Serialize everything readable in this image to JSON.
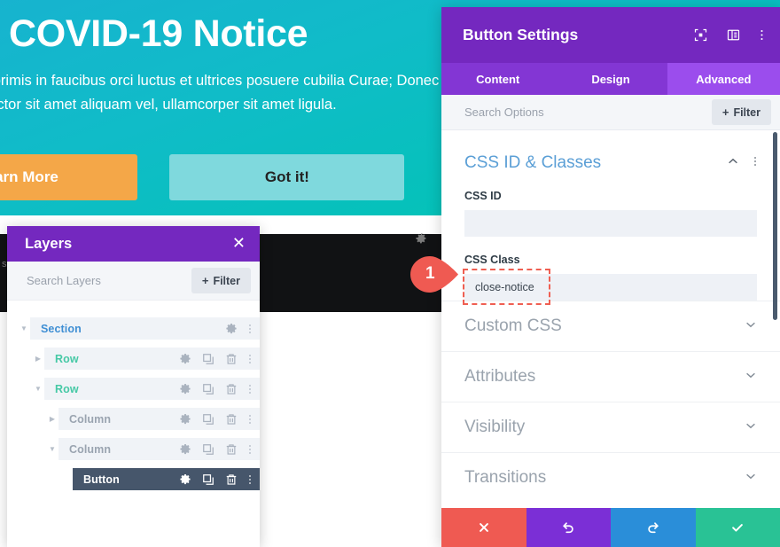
{
  "hero": {
    "title": "COVID-19 Notice",
    "body": "n primis in faucibus orci luctus et ultrices posuere cubilia Curae; Donec e, auctor sit amet aliquam vel, ullamcorper sit amet ligula.",
    "learn_more_label": "arn More",
    "got_it_label": "Got it!",
    "gradient_start": "#17b3cf",
    "gradient_end": "#00c6b2",
    "learn_more_color": "#f4a748",
    "got_it_color": "#7fd9dd"
  },
  "dark_strip": {
    "edge_text": "s"
  },
  "layers_panel": {
    "title": "Layers",
    "close_icon": "close-icon",
    "search_placeholder": "Search Layers",
    "search_value": "",
    "filter_label": "Filter",
    "filter_plus": "+",
    "tree": [
      {
        "label": "Section",
        "type": "section",
        "depth": 0,
        "expanded": true,
        "selected": false,
        "icons": [
          "gear-icon",
          "dots-icon"
        ]
      },
      {
        "label": "Row",
        "type": "row",
        "depth": 1,
        "expanded": false,
        "selected": false,
        "icons": [
          "gear-icon",
          "duplicate-icon",
          "trash-icon",
          "dots-icon"
        ]
      },
      {
        "label": "Row",
        "type": "row",
        "depth": 1,
        "expanded": true,
        "selected": false,
        "icons": [
          "gear-icon",
          "duplicate-icon",
          "trash-icon",
          "dots-icon"
        ]
      },
      {
        "label": "Column",
        "type": "column",
        "depth": 2,
        "expanded": false,
        "selected": false,
        "icons": [
          "gear-icon",
          "duplicate-icon",
          "trash-icon",
          "dots-icon"
        ]
      },
      {
        "label": "Column",
        "type": "column",
        "depth": 2,
        "expanded": true,
        "selected": false,
        "icons": [
          "gear-icon",
          "duplicate-icon",
          "trash-icon",
          "dots-icon"
        ]
      },
      {
        "label": "Button",
        "type": "module",
        "depth": 3,
        "expanded": null,
        "selected": true,
        "icons": [
          "gear-icon",
          "duplicate-icon",
          "trash-icon",
          "dots-icon"
        ]
      }
    ]
  },
  "settings_panel": {
    "title": "Button Settings",
    "header_icons": [
      "focus-icon",
      "layout-icon",
      "dots-icon"
    ],
    "tabs": [
      {
        "label": "Content",
        "active": false
      },
      {
        "label": "Design",
        "active": false
      },
      {
        "label": "Advanced",
        "active": true
      }
    ],
    "search_placeholder": "Search Options",
    "search_value": "",
    "filter_label": "Filter",
    "filter_plus": "+",
    "open_group": {
      "title": "CSS ID & Classes",
      "collapse_icon": "chevron-up-icon",
      "menu_icon": "dots-icon",
      "fields": [
        {
          "label": "CSS ID",
          "value": "",
          "highlighted": false
        },
        {
          "label": "CSS Class",
          "value": "close-notice",
          "highlighted": true
        }
      ]
    },
    "closed_groups": [
      {
        "title": "Custom CSS",
        "chevron": "chevron-down-icon"
      },
      {
        "title": "Attributes",
        "chevron": "chevron-down-icon"
      },
      {
        "title": "Visibility",
        "chevron": "chevron-down-icon"
      },
      {
        "title": "Transitions",
        "chevron": "chevron-down-icon"
      }
    ],
    "footer_buttons": [
      {
        "name": "cancel",
        "icon": "close-icon",
        "color": "#ef5a52"
      },
      {
        "name": "undo",
        "icon": "undo-icon",
        "color": "#7b2fd6"
      },
      {
        "name": "redo",
        "icon": "redo-icon",
        "color": "#2a8ed9"
      },
      {
        "name": "save",
        "icon": "check-icon",
        "color": "#29c295"
      }
    ],
    "header_color": "#7428bf",
    "highlight_color": "#ef5f52"
  },
  "annotation": {
    "number": "1",
    "color": "#ef5a52"
  }
}
